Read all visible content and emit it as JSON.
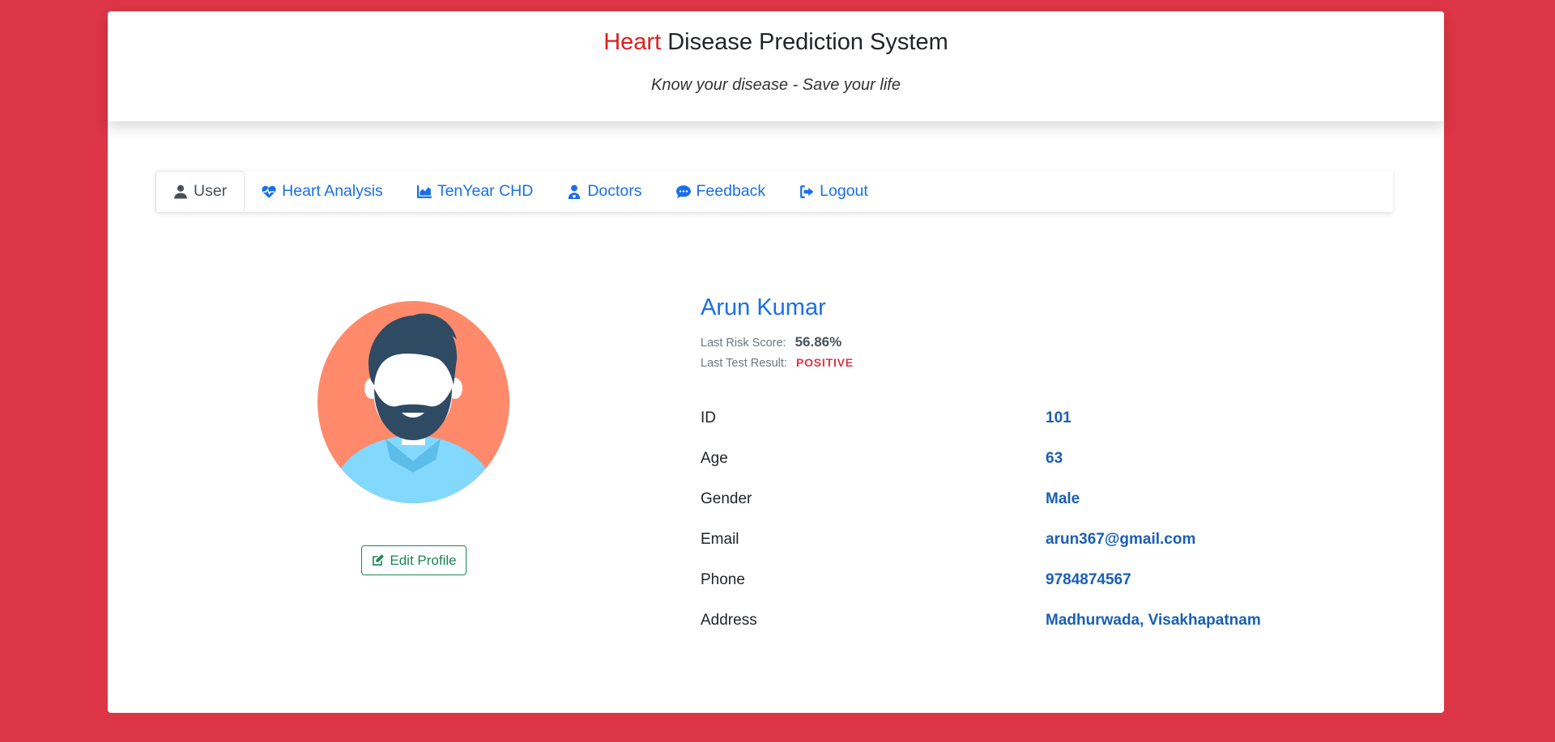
{
  "header": {
    "title_accent": "Heart",
    "title_rest": "Disease Prediction System",
    "tagline": "Know your disease - Save your life"
  },
  "nav": {
    "tabs": [
      {
        "label": "User",
        "icon": "user-icon",
        "active": true
      },
      {
        "label": "Heart Analysis",
        "icon": "heartbeat-icon",
        "active": false
      },
      {
        "label": "TenYear CHD",
        "icon": "area-chart-icon",
        "active": false
      },
      {
        "label": "Doctors",
        "icon": "user-doctor-icon",
        "active": false
      },
      {
        "label": "Feedback",
        "icon": "comment-dots-icon",
        "active": false
      },
      {
        "label": "Logout",
        "icon": "sign-out-icon",
        "active": false
      }
    ]
  },
  "profile": {
    "name": "Arun Kumar",
    "risk_label": "Last Risk Score:",
    "risk_value": "56.86%",
    "result_label": "Last Test Result:",
    "result_value": "POSITIVE",
    "edit_label": "Edit Profile",
    "fields": [
      {
        "label": "ID",
        "value": "101"
      },
      {
        "label": "Age",
        "value": "63"
      },
      {
        "label": "Gender",
        "value": "Male"
      },
      {
        "label": "Email",
        "value": "arun367@gmail.com"
      },
      {
        "label": "Phone",
        "value": "9784874567"
      },
      {
        "label": "Address",
        "value": "Madhurwada, Visakhapatnam"
      }
    ]
  },
  "colors": {
    "background": "#dc3545",
    "accent": "#dc1e1e",
    "link": "#1a6fe8",
    "value": "#1a5fb4",
    "positive": "#dc3545",
    "edit": "#198754"
  }
}
